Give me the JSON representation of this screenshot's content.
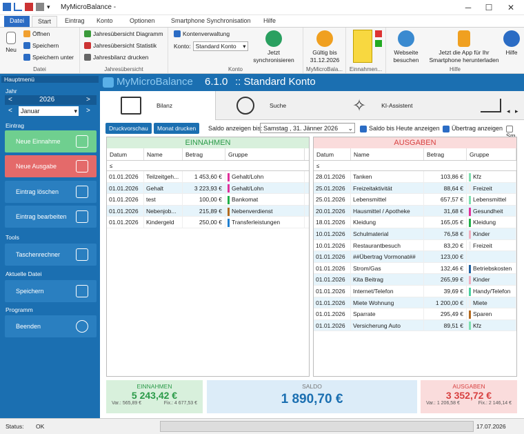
{
  "window": {
    "title": "MyMicroBalance -",
    "minimize": "─",
    "maximize": "☐",
    "close": "✕"
  },
  "menu": {
    "tabs": [
      "Datei",
      "Start",
      "Eintrag",
      "Konto",
      "Optionen",
      "Smartphone Synchronisation",
      "Hilfe"
    ]
  },
  "ribbon": {
    "datei": {
      "neu": "Neu",
      "oeffnen": "Öffnen",
      "speichern": "Speichern",
      "speichern_unter": "Speichern unter",
      "group": "Datei"
    },
    "jahr": {
      "diagramm": "Jahresübersicht Diagramm",
      "statistik": "Jahresübersicht Statistik",
      "bilanz": "Jahresbilanz drucken",
      "group": "Jahresübersicht"
    },
    "konto": {
      "verwaltung": "Kontenverwaltung",
      "konto_label": "Konto:",
      "konto_value": "Standard Konto",
      "sync": "Jetzt synchronisieren",
      "group": "Konto"
    },
    "lizenz": {
      "gueltig": "Gültig bis",
      "datum": "31.12.2026",
      "group": "MyMicroBala..."
    },
    "einnahmen": {
      "group": "Einnahmen..."
    },
    "hilfe": {
      "webseite": "Webseite besuchen",
      "app": "Jetzt die App für Ihr Smartphone herunterladen",
      "hilfe": "Hilfe",
      "group": "Hilfe"
    }
  },
  "sidebar": {
    "header": "Hauptmenü",
    "jahr_label": "Jahr",
    "year": "2026",
    "month": "Januar",
    "eintrag_label": "Eintrag",
    "neue_einnahme": "Neue Einnahme",
    "neue_ausgabe": "Neue Ausgabe",
    "eintrag_loeschen": "Eintrag löschen",
    "eintrag_bearbeiten": "Eintrag bearbeiten",
    "tools_label": "Tools",
    "taschenrechner": "Taschenrechner",
    "datei_label": "Aktuelle Datei",
    "speichern": "Speichern",
    "programm_label": "Programm",
    "beenden": "Beenden"
  },
  "banner": {
    "app": "MyMicroBalance",
    "version": "6.1.0",
    "konto": ":: Standard Konto"
  },
  "tabs": [
    "Bilanz",
    "Suche",
    "KI-Assistent"
  ],
  "options": {
    "druckvorschau": "Druckvorschau",
    "monat_drucken": "Monat drucken",
    "saldo_label": "Saldo anzeigen bis:",
    "saldo_date": "Samstag , 31. Jänner 2026",
    "heute": "Saldo bis Heute anzeigen",
    "uebertrag": "Übertrag anzeigen",
    "sm": "Sm"
  },
  "einnahmen": {
    "title": "EINNAHMEN",
    "cols": [
      "Datum",
      "Name",
      "Betrag",
      "Gruppe"
    ],
    "filter": "≤",
    "rows": [
      {
        "d": "01.01.2026",
        "n": "Teilzeitgeh...",
        "b": "1 453,60 €",
        "g": "Gehalt/Lohn",
        "c": "#e0309b"
      },
      {
        "d": "01.01.2026",
        "n": "Gehalt",
        "b": "3 223,93 €",
        "g": "Gehalt/Lohn",
        "c": "#e0309b"
      },
      {
        "d": "01.01.2026",
        "n": "test",
        "b": "100,00 €",
        "g": "Bankomat",
        "c": "#22b04a"
      },
      {
        "d": "01.01.2026",
        "n": "Nebenjob...",
        "b": "215,89 €",
        "g": "Nebenverdienst",
        "c": "#b46a1e"
      },
      {
        "d": "01.01.2026",
        "n": "Kindergeld",
        "b": "250,00 €",
        "g": "Transferleistungen",
        "c": "#1e7fd0"
      }
    ]
  },
  "ausgaben": {
    "title": "AUSGABEN",
    "cols": [
      "Datum",
      "Name",
      "Betrag",
      "Gruppe"
    ],
    "filter": "≤",
    "rows": [
      {
        "d": "28.01.2026",
        "n": "Tanken",
        "b": "103,86 €",
        "g": "Kfz",
        "c": "#7fe0b0"
      },
      {
        "d": "25.01.2026",
        "n": "Freizeitaktivität",
        "b": "88,64 €",
        "g": "Freizeit",
        "c": "#f0f0f0"
      },
      {
        "d": "25.01.2026",
        "n": "Lebensmittel",
        "b": "657,57 €",
        "g": "Lebensmittel",
        "c": "#7fe0b0"
      },
      {
        "d": "20.01.2026",
        "n": "Hausmittel / Apotheke",
        "b": "31,68 €",
        "g": "Gesundheit",
        "c": "#e0309b"
      },
      {
        "d": "18.01.2026",
        "n": "Kleidung",
        "b": "165,05 €",
        "g": "Kleidung",
        "c": "#22b04a"
      },
      {
        "d": "10.01.2026",
        "n": "Schulmaterial",
        "b": "76,58 €",
        "g": "Kinder",
        "c": "#f0b0c0"
      },
      {
        "d": "10.01.2026",
        "n": "Restaurantbesuch",
        "b": "83,20 €",
        "g": "Freizeit",
        "c": "#f0f0f0"
      },
      {
        "d": "01.01.2026",
        "n": "##Übertrag Vormonat##",
        "b": "123,00 €",
        "g": "",
        "c": ""
      },
      {
        "d": "01.01.2026",
        "n": "Strom/Gas",
        "b": "132,46 €",
        "g": "Betriebskosten",
        "c": "#1e5fa0"
      },
      {
        "d": "01.01.2026",
        "n": "Kita Beitrag",
        "b": "265,99 €",
        "g": "Kinder",
        "c": "#f0b0c0"
      },
      {
        "d": "01.01.2026",
        "n": "Internet/Telefon",
        "b": "39,69 €",
        "g": "Handy/Telefon",
        "c": "#4ad0a0"
      },
      {
        "d": "01.01.2026",
        "n": "Miete Wohnung",
        "b": "1 200,00 €",
        "g": "Miete",
        "c": "#f0f0f0"
      },
      {
        "d": "01.01.2026",
        "n": "Sparrate",
        "b": "295,49 €",
        "g": "Sparen",
        "c": "#b46a1e"
      },
      {
        "d": "01.01.2026",
        "n": "Versicherung Auto",
        "b": "89,51 €",
        "g": "Kfz",
        "c": "#7fe0b0"
      }
    ]
  },
  "summary": {
    "einnahmen": {
      "label": "EINNAHMEN",
      "value": "5 243,42 €",
      "var": "Var.: 565,89 €",
      "fix": "Fix.: 4 677,53 €"
    },
    "saldo": {
      "label": "SALDO",
      "value": "1 890,70 €"
    },
    "ausgaben": {
      "label": "AUSGABEN",
      "value": "3 352,72 €",
      "var": "Var.: 1 206,58 €",
      "fix": "Fix.: 2 146,14 €"
    }
  },
  "status": {
    "label": "Status:",
    "value": "OK",
    "date": "17.07.2026"
  }
}
